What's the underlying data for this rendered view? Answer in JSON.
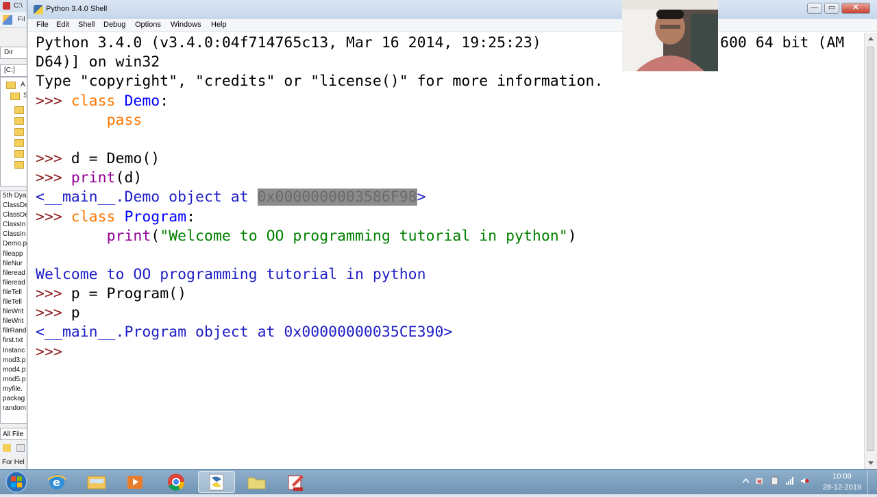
{
  "background_window": {
    "title_fragment": "C:\\",
    "toolbar_fragment": "Fil",
    "combo1": "Dir",
    "combo2": "[C:]",
    "tree_items": [
      "A",
      "S"
    ],
    "files": [
      "5th Dya",
      "ClassDe",
      "ClassDe",
      "ClassIn",
      "ClassIn",
      "Demo.p",
      "fileapp",
      "fileNur",
      "fileread",
      "fileread",
      "fileTell",
      "fileTell",
      "fileWrit",
      "fileWrit",
      "filrRand",
      "first.txt",
      "Instanc",
      "mod3.p",
      "mod4.p",
      "mod5.p",
      "myfile.",
      "packag",
      "random"
    ],
    "filter": "All File",
    "help": "For Hel"
  },
  "window": {
    "title": "Python 3.4.0 Shell",
    "menu": [
      "File",
      "Edit",
      "Shell",
      "Debug",
      "Options",
      "Windows",
      "Help"
    ],
    "btn_min": "—",
    "btn_max": "▭",
    "btn_close": "✕"
  },
  "shell": {
    "banner1a": "Python 3.4.0 (v3.4.0:04f714765c13, Mar 16 2014, 19:25:23)",
    "banner1b": "600 64 bit (AM",
    "banner2": "D64)] on win32",
    "banner3": "Type \"copyright\", \"credits\" or \"license()\" for more information.",
    "prompt": ">>> ",
    "l4_kw": "class",
    "l4_name": "Demo",
    "l4_rest": ":",
    "l5_kw": "pass",
    "l6": "d = Demo()",
    "l7_bi": "print",
    "l7_rest": "(d)",
    "l8_pre": "<__main__.Demo object at ",
    "l8_hl": "0x0000000003586F98",
    "l8_post": ">",
    "l9_kw": "class",
    "l9_name": "Program",
    "l9_rest": ":",
    "l10_bi": "print",
    "l10_open": "(",
    "l10_str": "\"Welcome to OO programming tutorial in python\"",
    "l10_close": ")",
    "l11": "Welcome to OO programming tutorial in python",
    "l12": "p = Program()",
    "l13": "p",
    "l14": "<__main__.Program object at 0x00000000035CE390>"
  },
  "taskbar": {
    "time": "10:09",
    "date": "28-12-2019",
    "apps": [
      "internet-explorer",
      "file-explorer",
      "media-player",
      "chrome",
      "python-idle",
      "folder",
      "pdf-editor"
    ]
  },
  "colors": {
    "prompt": "#8f1f1f",
    "keyword": "#ff7700",
    "definition": "#0000ff",
    "builtin": "#900090",
    "string": "#008000",
    "output": "#1e1ec8"
  }
}
